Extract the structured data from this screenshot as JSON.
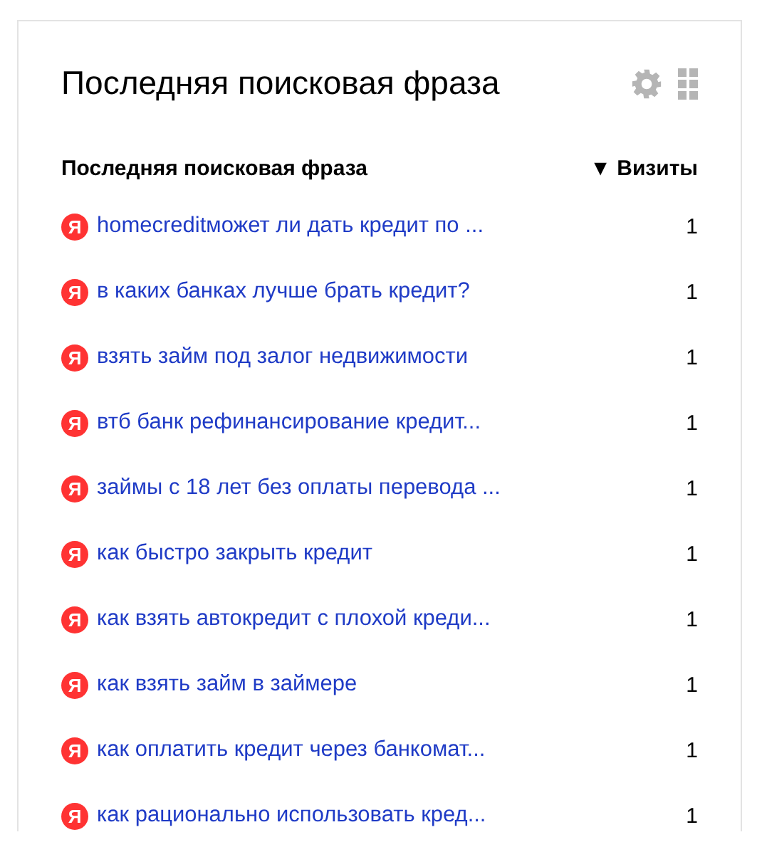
{
  "widget": {
    "title": "Последняя поисковая фраза"
  },
  "table": {
    "columns": [
      {
        "label": "Последняя поисковая фраза",
        "sorted": false
      },
      {
        "label": "Визиты",
        "sorted": true,
        "sort_mark": "▼"
      }
    ],
    "rows": [
      {
        "source": "Я",
        "phrase": "homecreditможет ли дать кредит по ...",
        "visits": "1"
      },
      {
        "source": "Я",
        "phrase": "в каких банках лучше брать кредит?",
        "visits": "1"
      },
      {
        "source": "Я",
        "phrase": "взять займ под залог недвижимости",
        "visits": "1"
      },
      {
        "source": "Я",
        "phrase": "втб банк рефинансирование кредит...",
        "visits": "1"
      },
      {
        "source": "Я",
        "phrase": "займы с 18 лет без оплаты перевода ...",
        "visits": "1"
      },
      {
        "source": "Я",
        "phrase": "как быстро закрыть кредит",
        "visits": "1"
      },
      {
        "source": "Я",
        "phrase": "как взять автокредит с плохой креди...",
        "visits": "1"
      },
      {
        "source": "Я",
        "phrase": "как взять займ в займере",
        "visits": "1"
      },
      {
        "source": "Я",
        "phrase": "как оплатить кредит через банкомат...",
        "visits": "1"
      },
      {
        "source": "Я",
        "phrase": "как рационально использовать кред...",
        "visits": "1"
      }
    ]
  }
}
